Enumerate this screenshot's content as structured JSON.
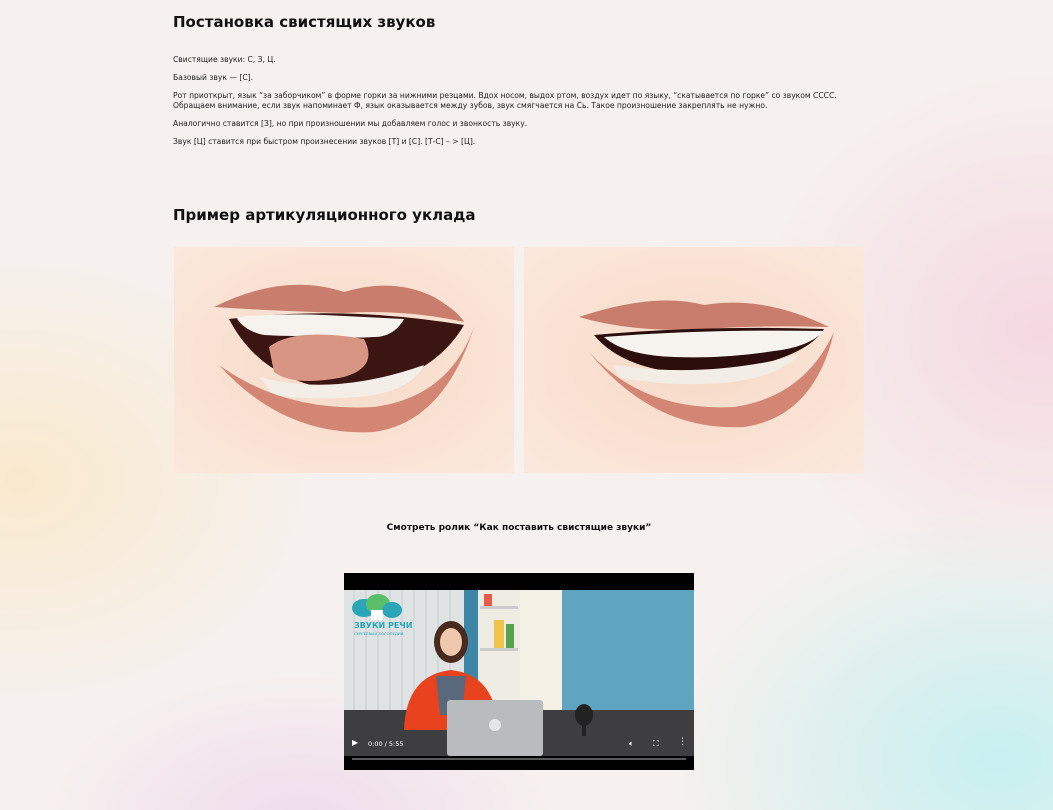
{
  "section1": {
    "title": "Постановка свистящих звуков",
    "paragraphs": [
      "Свистящие звуки: С, З, Ц.",
      "Базовый звук — [С].",
      "Рот приоткрыт, язык “за заборчиком” в форме горки за нижними резцами. Вдох носом, выдох ртом, воздух идет по языку, “скатывается по горке” со звуком СССС. Обращаем внимание, если звук напоминает Ф, язык оказывается между зубов, звук смягчается на Сь. Такое произношение закреплять не нужно.",
      "Аналогично ставится [З], но при произношении мы добавляем голос и звонкость звуку.",
      "Звук [Ц] ставится при быстром произнесении звуков [Т] и [С]. [Т-С] – > [Ц]."
    ]
  },
  "section2": {
    "title": "Пример артикуляционного уклада"
  },
  "video": {
    "caption": "Смотреть ролик “Как поставить свистящие звуки”",
    "logo_text": "ЗВУКИ РЕЧИ",
    "logo_sub": "СЕРГЕЕВЫЙ ЛОГОПЕДИИ",
    "time": "0:00 / 5:55",
    "progress": 0,
    "icons": {
      "play": "play-icon",
      "volume": "volume-icon",
      "fullscreen": "fullscreen-icon",
      "more": "more-vert-icon"
    }
  },
  "colors": {
    "accent_teal": "#2aa6b8",
    "wall_blue": "#5fa5bf",
    "shirt_orange": "#e8431e"
  }
}
